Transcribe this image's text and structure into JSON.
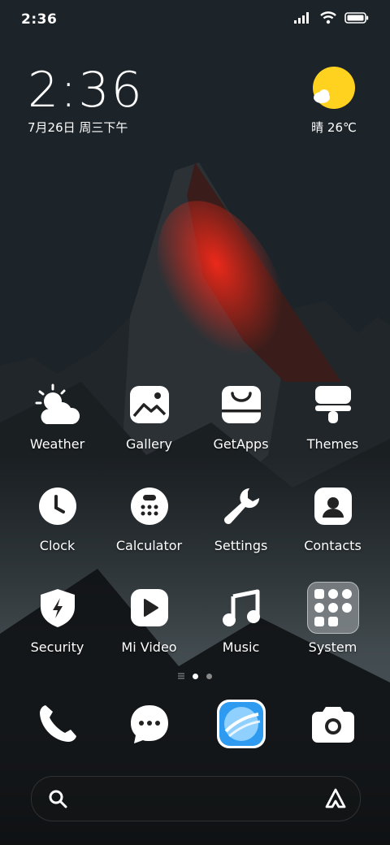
{
  "status_bar": {
    "time": "2:36"
  },
  "clock_widget": {
    "time": "2:36",
    "date": "7月26日 周三下午"
  },
  "weather_widget": {
    "label": "晴 26℃",
    "icon": "partly-sunny-icon"
  },
  "apps": [
    {
      "label": "Weather",
      "icon": "weather-icon"
    },
    {
      "label": "Gallery",
      "icon": "gallery-icon"
    },
    {
      "label": "GetApps",
      "icon": "getapps-icon"
    },
    {
      "label": "Themes",
      "icon": "themes-icon"
    },
    {
      "label": "Clock",
      "icon": "clock-icon"
    },
    {
      "label": "Calculator",
      "icon": "calculator-icon"
    },
    {
      "label": "Settings",
      "icon": "settings-icon"
    },
    {
      "label": "Contacts",
      "icon": "contacts-icon"
    },
    {
      "label": "Security",
      "icon": "security-icon"
    },
    {
      "label": "Mi Video",
      "icon": "mi-video-icon"
    },
    {
      "label": "Music",
      "icon": "music-icon"
    },
    {
      "label": "System",
      "icon": "system-folder-icon"
    }
  ],
  "page_indicator": {
    "pages": 2,
    "current": 1
  },
  "dock": [
    "phone-icon",
    "messages-icon",
    "browser-icon",
    "camera-icon"
  ],
  "colors": {
    "sun": "#FFD21F",
    "browser_blue": "#2E9BF0",
    "accent_red": "#E0301E"
  }
}
